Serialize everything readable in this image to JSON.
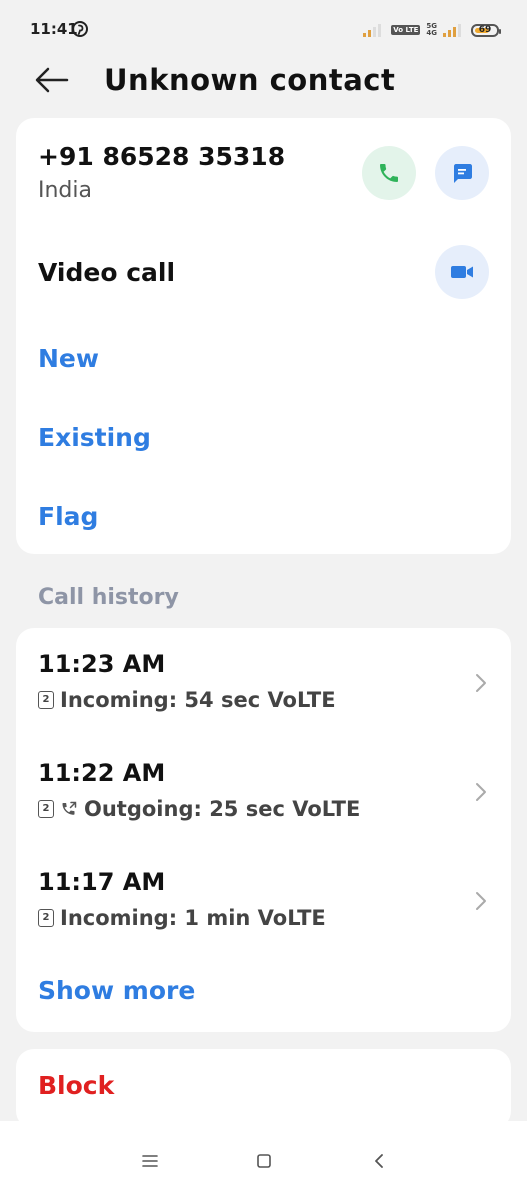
{
  "status_bar": {
    "time": "11:41",
    "battery": "69",
    "battery_level": 0.69,
    "network_tags": [
      "Vo LTE",
      "5G",
      "4G"
    ]
  },
  "header": {
    "title": "Unknown contact"
  },
  "contact": {
    "number": "+91 86528 35318",
    "region": "India",
    "video_call_label": "Video call",
    "actions": [
      "New",
      "Existing",
      "Flag"
    ]
  },
  "call_history": {
    "title": "Call history",
    "items": [
      {
        "time": "11:23 AM",
        "sim": "2",
        "direction_icon": "",
        "detail": "Incoming: 54 sec VoLTE"
      },
      {
        "time": "11:22 AM",
        "sim": "2",
        "direction_icon": "outgoing-call-icon",
        "detail": "Outgoing: 25 sec VoLTE"
      },
      {
        "time": "11:17 AM",
        "sim": "2",
        "direction_icon": "",
        "detail": "Incoming: 1 min VoLTE"
      }
    ],
    "show_more": "Show more"
  },
  "block": {
    "label": "Block"
  },
  "colors": {
    "accent": "#2f7de1",
    "danger": "#e02020",
    "call_green": "#2fb35a",
    "section_gray": "#8e95a6"
  }
}
